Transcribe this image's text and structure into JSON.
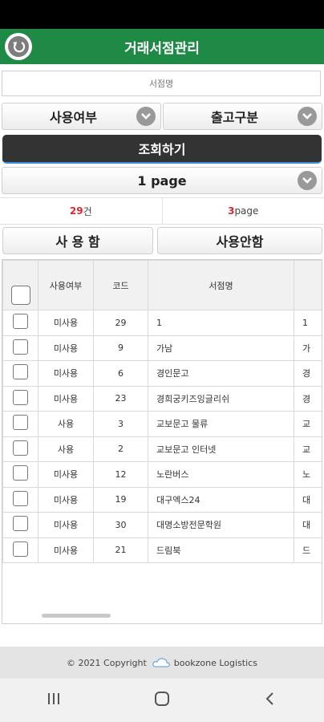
{
  "header": {
    "title": "거래서점관리"
  },
  "search": {
    "placeholder": "서점명"
  },
  "filters": {
    "usage_label": "사용여부",
    "release_label": "출고구분"
  },
  "query_button": "조회하기",
  "page_select": "1 page",
  "summary": {
    "count_value": "29",
    "count_unit": "건",
    "pages_value": "3",
    "pages_unit": "page"
  },
  "actions": {
    "use_label": "사 용 함",
    "unuse_label": "사용안함"
  },
  "table": {
    "columns": [
      "사용여부",
      "코드",
      "서점명",
      ""
    ],
    "rows": [
      {
        "status": "미사용",
        "code": "29",
        "name": "1",
        "extra": "1"
      },
      {
        "status": "미사용",
        "code": "9",
        "name": "가남",
        "extra": "가"
      },
      {
        "status": "미사용",
        "code": "6",
        "name": "경인문고",
        "extra": "경"
      },
      {
        "status": "미사용",
        "code": "23",
        "name": "경희궁키즈잉글리쉬",
        "extra": "경"
      },
      {
        "status": "사용",
        "code": "3",
        "name": "교보문고 물류",
        "extra": "교"
      },
      {
        "status": "사용",
        "code": "2",
        "name": "교보문고 인터넷",
        "extra": "교"
      },
      {
        "status": "미사용",
        "code": "12",
        "name": "노란버스",
        "extra": "노"
      },
      {
        "status": "미사용",
        "code": "19",
        "name": "대구엑스24",
        "extra": "대"
      },
      {
        "status": "미사용",
        "code": "30",
        "name": "대명소방전문학원",
        "extra": "대"
      },
      {
        "status": "미사용",
        "code": "21",
        "name": "드림북",
        "extra": "드"
      }
    ]
  },
  "footer": {
    "copyright": "© 2021 Copyright",
    "brand": "bookzone Logistics"
  },
  "colors": {
    "header_bg": "#1e8a46",
    "query_button_bg": "#333333",
    "count_red": "#e0262c"
  }
}
